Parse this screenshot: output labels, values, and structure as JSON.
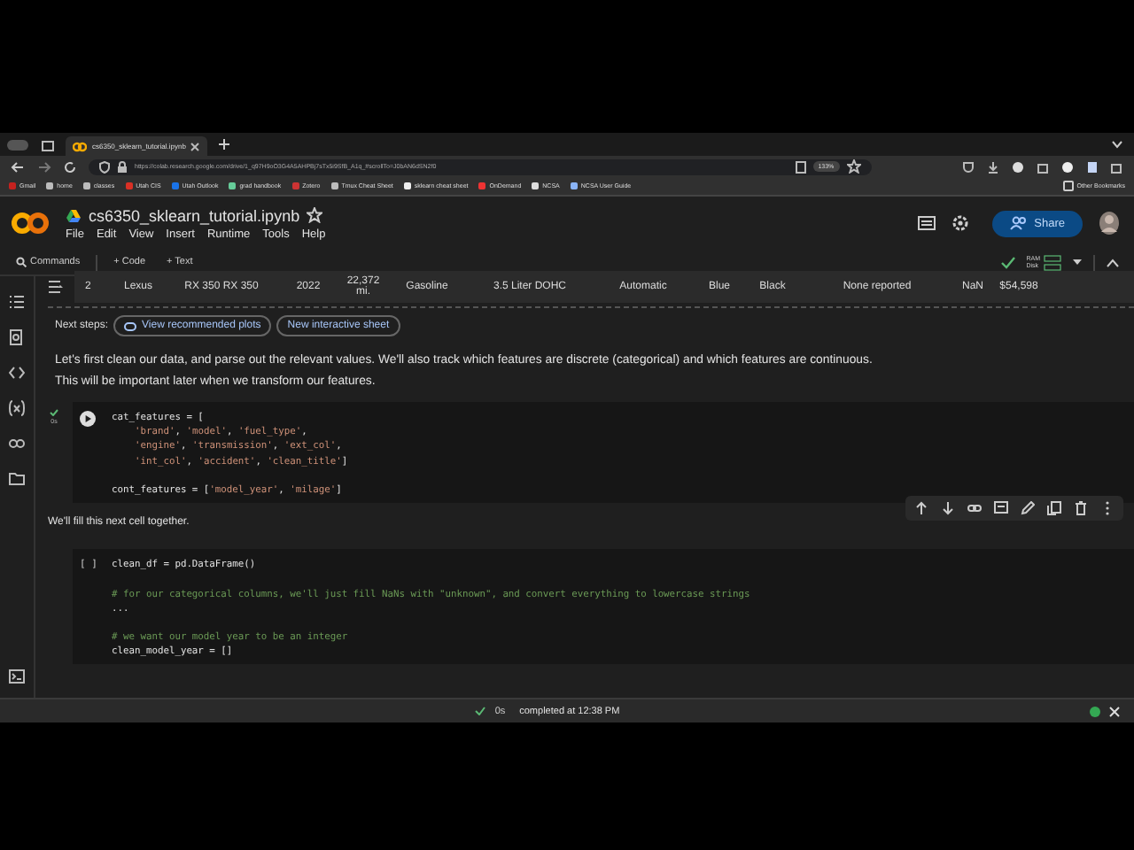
{
  "browser": {
    "tab_title": "cs6350_sklearn_tutorial.ipynb",
    "url": "https://colab.research.google.com/drive/1_q97H9oO3G4A5AHPBj7sTx5i9SfB_A1q_#scrollTo=J0bAN6dSN2f0",
    "zoom": "133%",
    "bookmarks": [
      "Gmail",
      "home",
      "classes",
      "Utah CIS",
      "Utah Outlook",
      "grad handbook",
      "Zotero",
      "Tmux Cheat Sheet",
      "sklearn cheat sheet",
      "OnDemand",
      "NCSA",
      "NCSA User Guide"
    ],
    "other_bookmarks": "Other Bookmarks"
  },
  "notebook": {
    "title": "cs6350_sklearn_tutorial.ipynb",
    "menu": [
      "File",
      "Edit",
      "View",
      "Insert",
      "Runtime",
      "Tools",
      "Help"
    ],
    "share": "Share"
  },
  "toolbar": {
    "commands": "Commands",
    "add_code": "+ Code",
    "add_text": "+ Text",
    "ram": "RAM",
    "disk": "Disk"
  },
  "table_row": [
    "2",
    "Lexus",
    "RX 350 RX 350",
    "2022",
    "22,372 mi.",
    "Gasoline",
    "3.5 Liter DOHC",
    "Automatic",
    "Blue",
    "Black",
    "None reported",
    "NaN",
    "$54,598"
  ],
  "next_steps": {
    "label": "Next steps:",
    "buttons": [
      "View recommended plots",
      "New interactive sheet"
    ]
  },
  "paragraph": "Let's first clean our data, and parse out the relevant values. We'll also track which features are discrete (categorical) and which features are continuous. This will be important later when we transform our features.",
  "cells": [
    {
      "kind": "code",
      "executed": true,
      "time": "0s",
      "lines": [
        {
          "indent": false,
          "gap_before": false,
          "tokens": [
            {
              "kind": "plain",
              "text": "cat_features = ["
            }
          ]
        },
        {
          "indent": true,
          "gap_before": false,
          "tokens": [
            {
              "kind": "string",
              "text": "'brand'"
            },
            {
              "kind": "plain",
              "text": ", "
            },
            {
              "kind": "string",
              "text": "'model'"
            },
            {
              "kind": "plain",
              "text": ", "
            },
            {
              "kind": "string",
              "text": "'fuel_type'"
            },
            {
              "kind": "plain",
              "text": ","
            }
          ]
        },
        {
          "indent": true,
          "gap_before": false,
          "tokens": [
            {
              "kind": "string",
              "text": "'engine'"
            },
            {
              "kind": "plain",
              "text": ", "
            },
            {
              "kind": "string",
              "text": "'transmission'"
            },
            {
              "kind": "plain",
              "text": ", "
            },
            {
              "kind": "string",
              "text": "'ext_col'"
            },
            {
              "kind": "plain",
              "text": ","
            }
          ]
        },
        {
          "indent": true,
          "gap_before": false,
          "tokens": [
            {
              "kind": "string",
              "text": "'int_col'"
            },
            {
              "kind": "plain",
              "text": ", "
            },
            {
              "kind": "string",
              "text": "'accident'"
            },
            {
              "kind": "plain",
              "text": ", "
            },
            {
              "kind": "string",
              "text": "'clean_title'"
            },
            {
              "kind": "plain",
              "text": "]"
            }
          ]
        },
        {
          "indent": false,
          "gap_before": true,
          "tokens": [
            {
              "kind": "plain",
              "text": "cont_features = ["
            },
            {
              "kind": "string",
              "text": "'model_year'"
            },
            {
              "kind": "plain",
              "text": ", "
            },
            {
              "kind": "string",
              "text": "'milage'"
            },
            {
              "kind": "plain",
              "text": "]"
            }
          ]
        }
      ]
    },
    {
      "kind": "text",
      "text": "We'll fill this next cell together."
    },
    {
      "kind": "code",
      "executed": false,
      "prompt": "[ ]",
      "lines": [
        {
          "indent": false,
          "gap_before": false,
          "tokens": [
            {
              "kind": "plain",
              "text": "clean_df = pd.DataFrame()"
            }
          ]
        },
        {
          "indent": false,
          "gap_before": true,
          "tokens": [
            {
              "kind": "comment",
              "text": "# for our categorical columns, we'll just fill NaNs with \"unknown\", and convert everything to lowercase strings"
            }
          ]
        },
        {
          "indent": false,
          "gap_before": false,
          "tokens": [
            {
              "kind": "plain",
              "text": "..."
            }
          ]
        },
        {
          "indent": false,
          "gap_before": true,
          "tokens": [
            {
              "kind": "comment",
              "text": "# we want our model year to be an integer"
            }
          ]
        },
        {
          "indent": false,
          "gap_before": false,
          "tokens": [
            {
              "kind": "plain",
              "text": "clean_model_year = []"
            }
          ]
        }
      ]
    }
  ],
  "status": {
    "time": "0s",
    "text": "completed at 12:38 PM"
  }
}
